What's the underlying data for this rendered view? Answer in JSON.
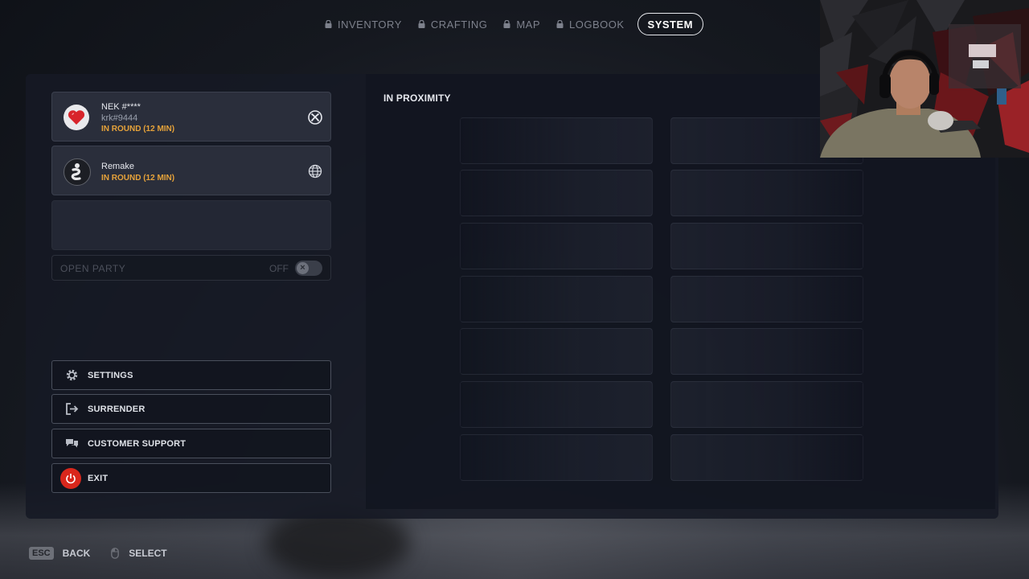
{
  "tabs": [
    {
      "label": "INVENTORY",
      "locked": true
    },
    {
      "label": "CRAFTING",
      "locked": true
    },
    {
      "label": "MAP",
      "locked": true
    },
    {
      "label": "LOGBOOK",
      "locked": true
    },
    {
      "label": "SYSTEM",
      "locked": false,
      "active": true
    }
  ],
  "party": {
    "members": [
      {
        "name": "NEK #****",
        "tag": "krk#9444",
        "status": "IN ROUND (12 MIN)",
        "platform_icon": "xbox-icon",
        "avatar_icon": "heart-icon"
      },
      {
        "name": "Remake",
        "tag": "",
        "status": "IN ROUND (12 MIN)",
        "platform_icon": "globe-icon",
        "avatar_icon": "snake-icon"
      }
    ],
    "open_party_label": "OPEN PARTY",
    "open_party_state": "OFF"
  },
  "menu": {
    "settings": "SETTINGS",
    "surrender": "SURRENDER",
    "support": "CUSTOMER SUPPORT",
    "exit": "EXIT"
  },
  "proximity": {
    "title": "IN PROXIMITY"
  },
  "hints": {
    "back_key": "ESC",
    "back_label": "BACK",
    "select_label": "SELECT"
  },
  "colors": {
    "status": "#e7a33a",
    "exit_red": "#d9271c"
  }
}
